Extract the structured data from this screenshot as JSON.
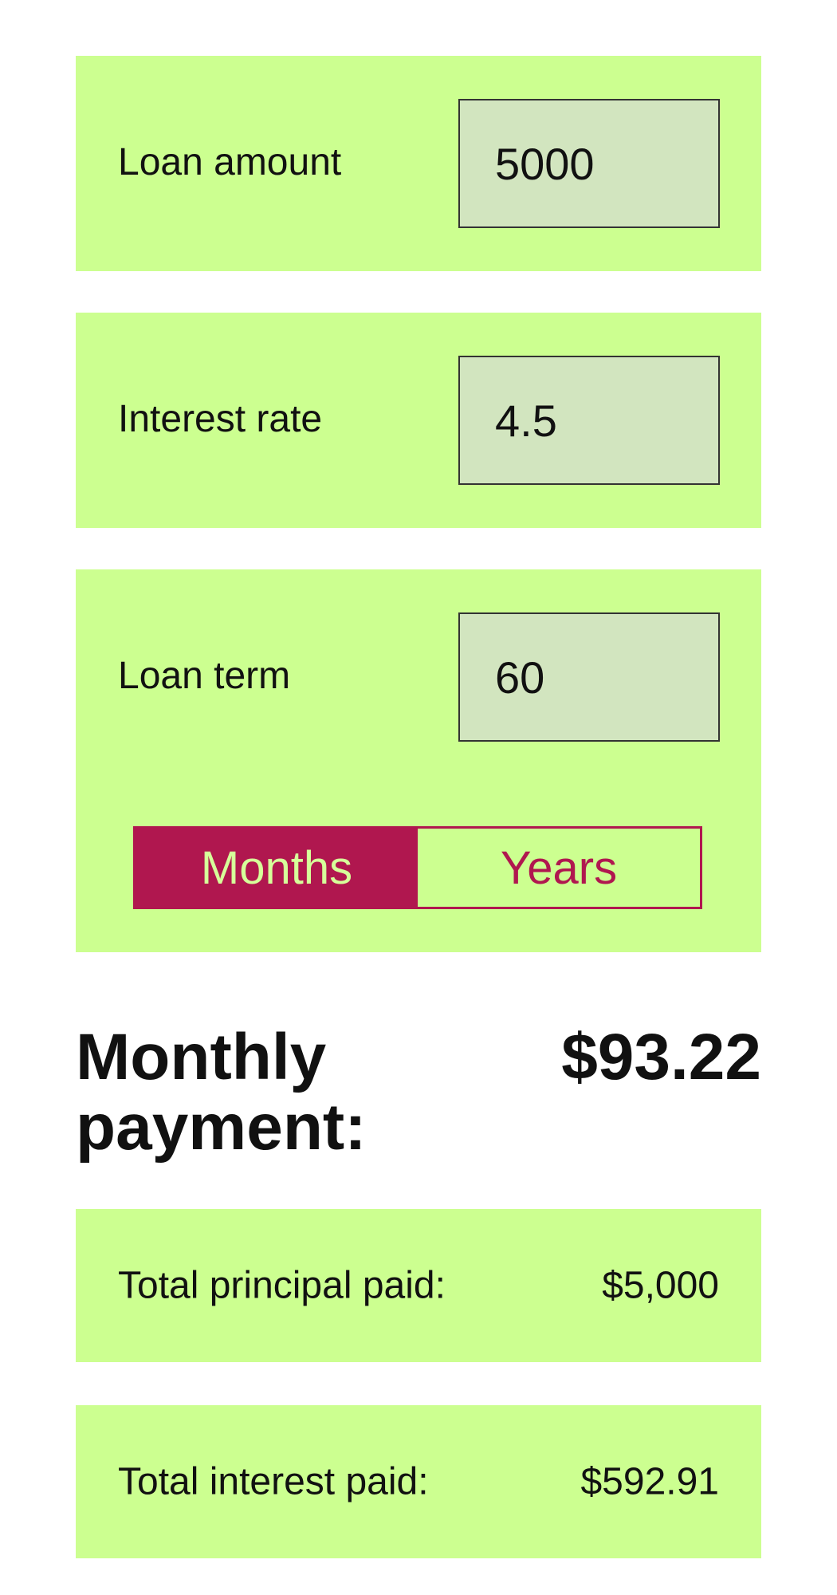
{
  "colors": {
    "panel_bg": "#ccff90",
    "input_bg": "#d2e5bf",
    "accent": "#b0174f",
    "active_text": "#d6ff9a"
  },
  "loan_amount": {
    "label": "Loan amount",
    "value": "5000"
  },
  "interest_rate": {
    "label": "Interest rate",
    "value": "4.5"
  },
  "loan_term": {
    "label": "Loan term",
    "value": "60",
    "units": [
      {
        "label": "Months",
        "selected": true
      },
      {
        "label": "Years",
        "selected": false
      }
    ]
  },
  "results": {
    "monthly_payment_label": "Monthly payment:",
    "monthly_payment_value": "$93.22",
    "total_principal_label": "Total principal paid:",
    "total_principal_value": "$5,000",
    "total_interest_label": "Total interest paid:",
    "total_interest_value": "$592.91"
  }
}
